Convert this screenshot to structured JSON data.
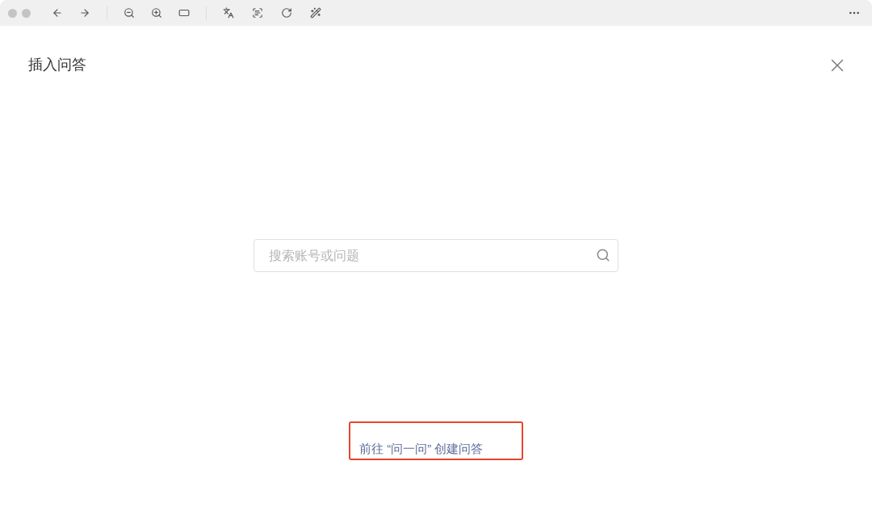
{
  "dialog": {
    "title": "插入问答"
  },
  "search": {
    "placeholder": "搜索账号或问题"
  },
  "create_link": {
    "label": "前往 “问一问” 创建问答"
  }
}
